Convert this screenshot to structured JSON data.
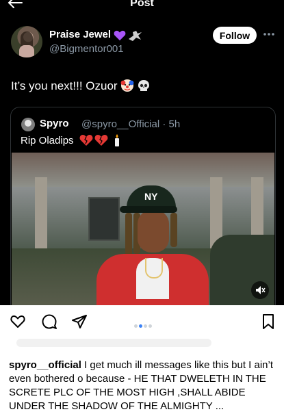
{
  "header": {
    "title": "Post",
    "back_icon": "arrow-left-icon"
  },
  "author": {
    "name": "Praise Jewel",
    "handle": "@Bigmentor001",
    "follow_label": "Follow",
    "badges": [
      "purple-heart-icon",
      "crow-icon"
    ]
  },
  "post": {
    "text": "It’s you next!!! Ozuor",
    "emojis": [
      "clown-face-icon",
      "skull-icon"
    ]
  },
  "quoted": {
    "name": "Spyro",
    "handle_time": "@spyro__Official · 5h",
    "text": "Rip Oladips",
    "emojis": [
      "broken-heart-icon",
      "broken-heart-icon",
      "candle-icon"
    ],
    "media": "video",
    "cap_logo": "NY"
  },
  "instagram": {
    "carousel_dots": 4,
    "active_dot": 1,
    "caption_user": "spyro__official",
    "caption_text": "I get much ill messages like this but I ain’t even bothered o because - HE THAT DWELETH IN THE SCRETE PLC OF THE MOST HIGH ,SHALL ABIDE UNDER THE SHADOW OF THE ALMIGHTY ..."
  },
  "colors": {
    "background": "#000000",
    "handle": "#8b98a5",
    "dot_active": "#3b82f6"
  }
}
